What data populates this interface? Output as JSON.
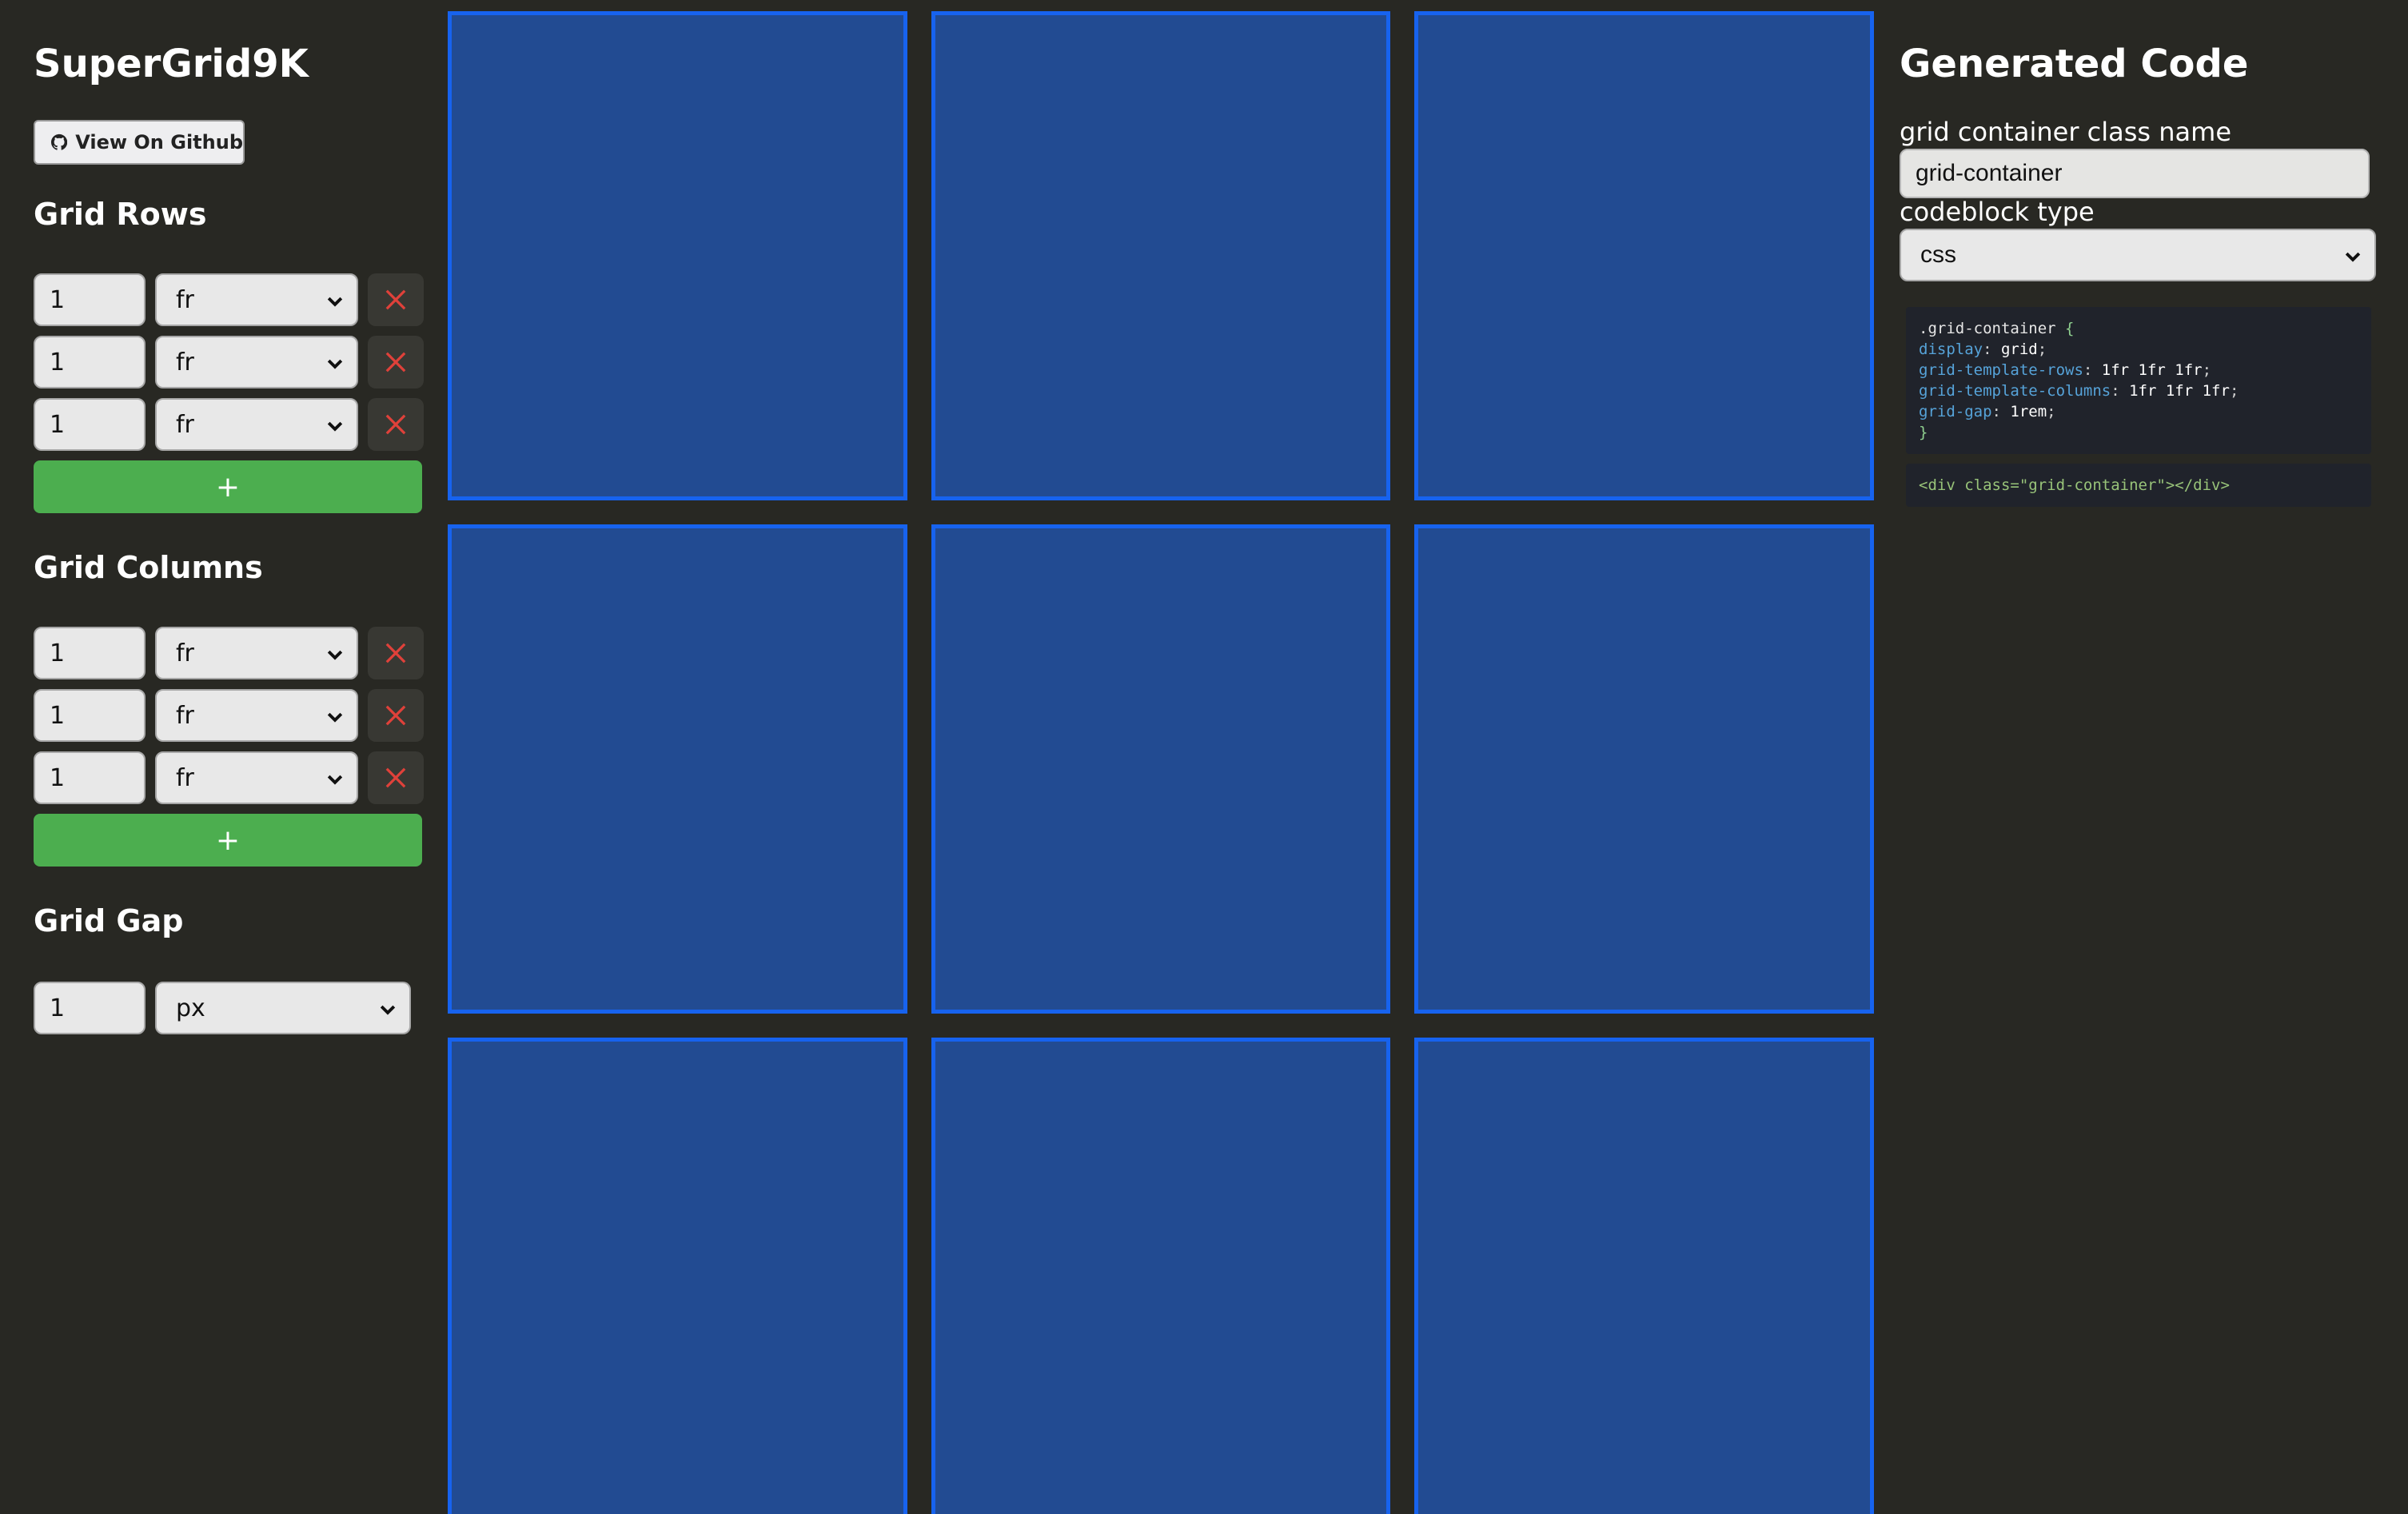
{
  "app": {
    "title": "SuperGrid9K",
    "github_label": "View On Github"
  },
  "rows": {
    "heading": "Grid Rows",
    "items": [
      {
        "value": "1",
        "unit": "fr"
      },
      {
        "value": "1",
        "unit": "fr"
      },
      {
        "value": "1",
        "unit": "fr"
      }
    ],
    "add_label": "+"
  },
  "columns": {
    "heading": "Grid Columns",
    "items": [
      {
        "value": "1",
        "unit": "fr"
      },
      {
        "value": "1",
        "unit": "fr"
      },
      {
        "value": "1",
        "unit": "fr"
      }
    ],
    "add_label": "+"
  },
  "gap": {
    "heading": "Grid Gap",
    "value": "1",
    "unit": "px"
  },
  "preview": {
    "cell_count": 9
  },
  "code": {
    "heading": "Generated Code",
    "class_label": "grid container class name",
    "class_value": "grid-container",
    "type_label": "codeblock type",
    "type_value": "css",
    "css_selector": ".grid-container",
    "css_lines": [
      {
        "prop": "display",
        "value": "grid"
      },
      {
        "prop": "grid-template-rows",
        "value": "1fr 1fr 1fr"
      },
      {
        "prop": "grid-template-columns",
        "value": "1fr 1fr 1fr"
      },
      {
        "prop": "grid-gap",
        "value": "1rem"
      }
    ],
    "html_snippet": "<div class=\"grid-container\"></div>"
  },
  "colors": {
    "background": "#282823",
    "cell_fill": "#224b92",
    "cell_border": "#1763ef",
    "add_button": "#4cae4f",
    "delete_icon": "#e0413a"
  },
  "icons": {
    "github": "github-icon",
    "delete": "close-icon",
    "dropdown": "chevron-down-icon"
  }
}
